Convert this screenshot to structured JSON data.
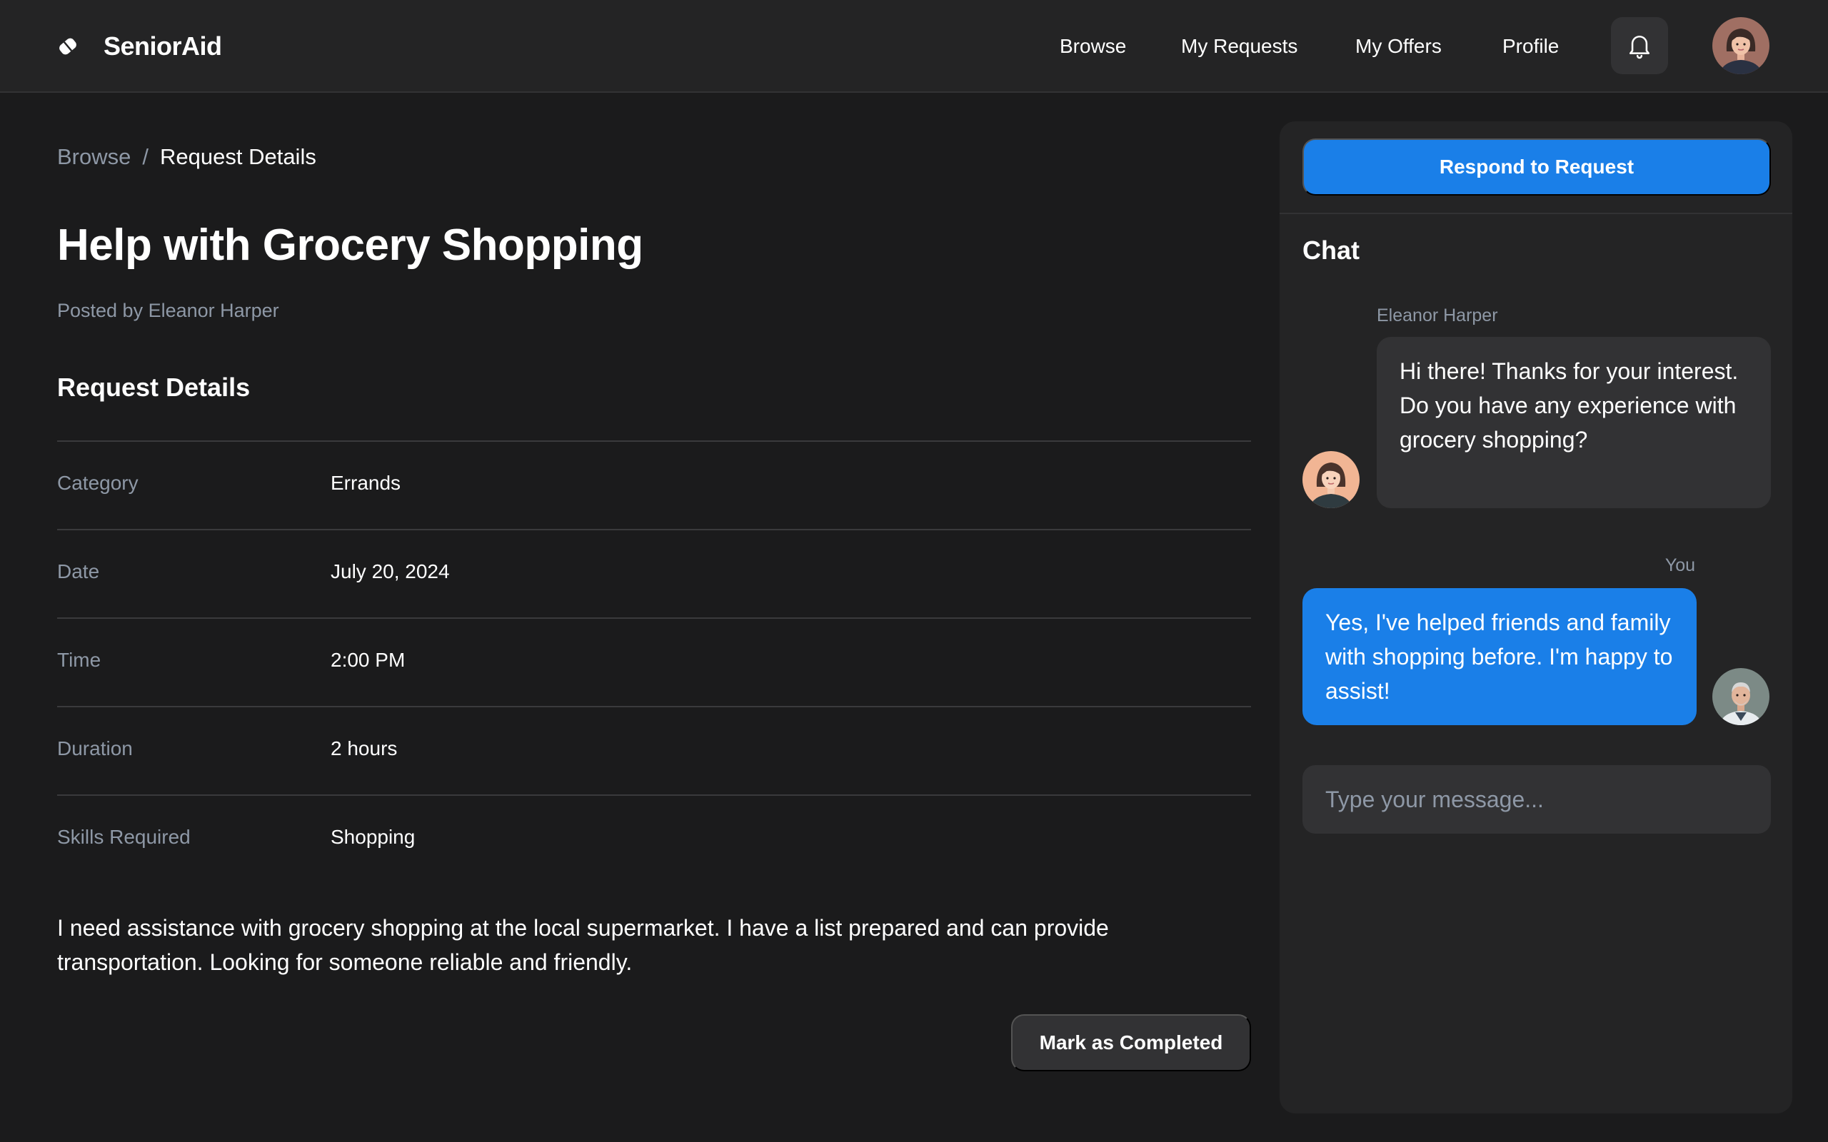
{
  "app": {
    "name": "SeniorAid"
  },
  "nav": {
    "items": [
      "Browse",
      "My Requests",
      "My Offers",
      "Profile"
    ]
  },
  "breadcrumb": {
    "parent": "Browse",
    "separator": "/",
    "current": "Request Details"
  },
  "request": {
    "title": "Help with Grocery Shopping",
    "posted_by": "Posted by Eleanor Harper",
    "section_title": "Request Details",
    "details": [
      {
        "label": "Category",
        "value": "Errands"
      },
      {
        "label": "Date",
        "value": "July 20, 2024"
      },
      {
        "label": "Time",
        "value": "2:00 PM"
      },
      {
        "label": "Duration",
        "value": "2 hours"
      },
      {
        "label": "Skills Required",
        "value": "Shopping"
      }
    ],
    "description": "I need assistance with grocery shopping at the local supermarket. I have a list prepared and can provide transportation. Looking for someone reliable and friendly.",
    "complete_label": "Mark as Completed"
  },
  "panel": {
    "respond_label": "Respond to Request",
    "chat_title": "Chat",
    "messages": [
      {
        "sender": "Eleanor Harper",
        "text": "Hi there! Thanks for your interest. Do you have any experience with grocery shopping?"
      },
      {
        "sender": "You",
        "text": "Yes, I've helped friends and family with shopping before. I'm happy to assist!"
      }
    ],
    "input_placeholder": "Type your message..."
  },
  "icons": {
    "logo": "logo-icon",
    "bell": "bell-icon",
    "avatar": "avatar"
  },
  "colors": {
    "accent": "#1a7fe8",
    "background": "#1b1b1c",
    "surface": "#242425",
    "muted_text": "#8e98a6"
  }
}
